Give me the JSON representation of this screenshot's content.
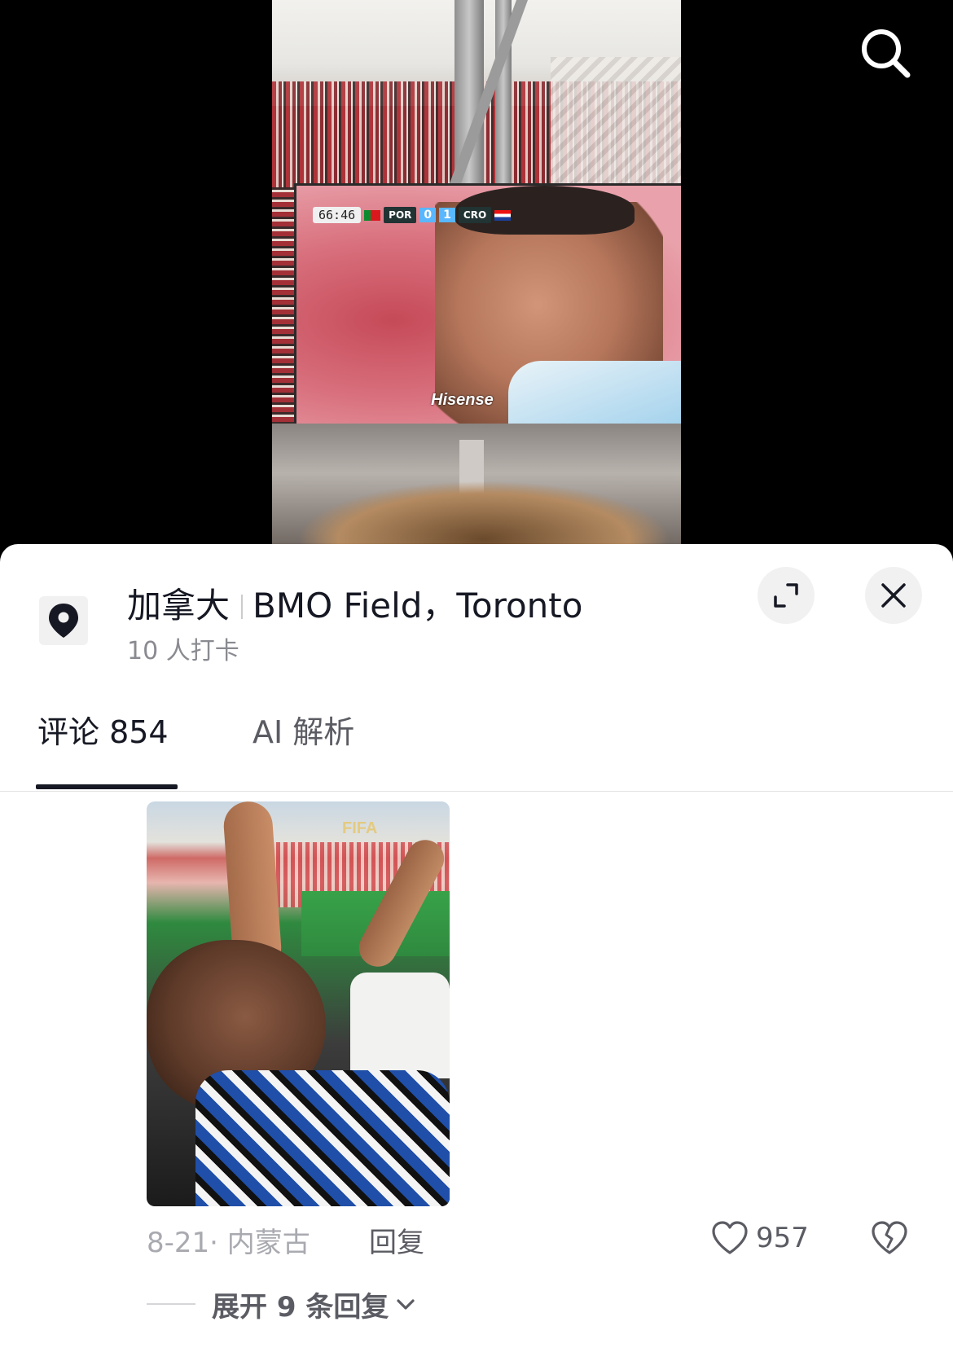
{
  "video": {
    "scoreboard": {
      "time": "66:46",
      "home_team": "POR",
      "home_score": "0",
      "away_score": "1",
      "away_team": "CRO"
    },
    "board_brand": "Hisense",
    "search_icon": "search-icon"
  },
  "location": {
    "country": "加拿大",
    "place": "BMO Field，Toronto",
    "checkins": "10 人打卡",
    "icon": "location-pin-icon"
  },
  "sheet_actions": {
    "expand_icon": "expand-icon",
    "close_icon": "close-icon"
  },
  "tabs": [
    {
      "label": "评论 854",
      "active": true
    },
    {
      "label": "AI 解析",
      "active": false
    }
  ],
  "comment": {
    "image_text": "FIFA",
    "date_location": "8-21· 内蒙古",
    "reply_label": "回复",
    "like_count": "957",
    "expand_replies_label": "展开 9 条回复"
  }
}
